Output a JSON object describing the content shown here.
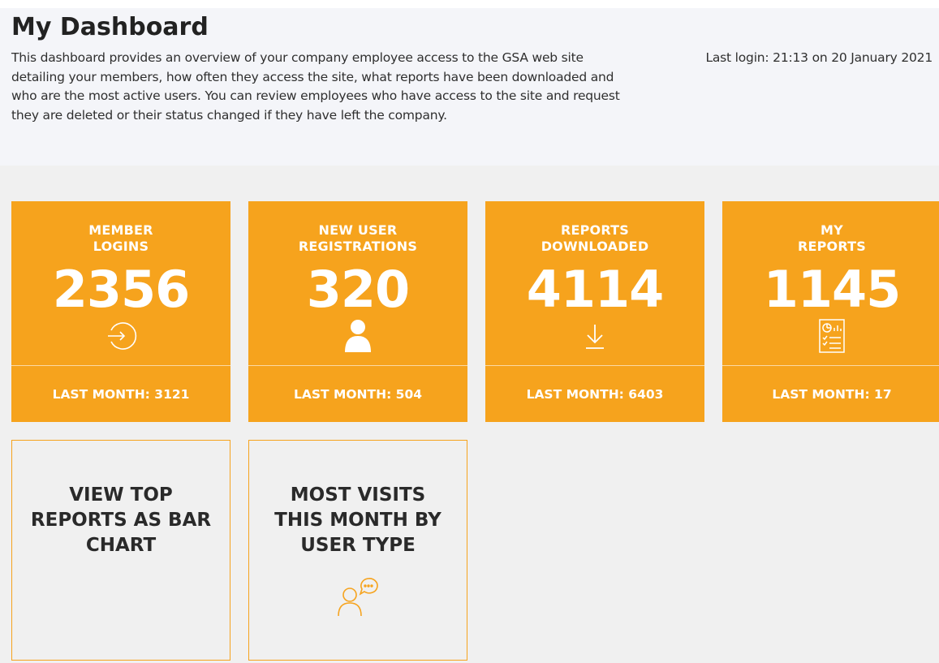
{
  "header": {
    "title": "My Dashboard",
    "description": "This dashboard provides an overview of your company employee access to the GSA web site detailing your members, how often they access the site, what reports have been downloaded and who are the most active users. You can review employees who have access to the site and request they are deleted or their status changed if they have left the company.",
    "last_login": "Last login: 21:13 on 20 January 2021"
  },
  "stats": [
    {
      "label_line1": "MEMBER",
      "label_line2": "LOGINS",
      "value": "2356",
      "icon": "login-icon",
      "footer": "LAST MONTH: 3121"
    },
    {
      "label_line1": "NEW USER",
      "label_line2": "REGISTRATIONS",
      "value": "320",
      "icon": "user-icon",
      "footer": "LAST MONTH: 504"
    },
    {
      "label_line1": "REPORTS",
      "label_line2": "DOWNLOADED",
      "value": "4114",
      "icon": "download-icon",
      "footer": "LAST MONTH: 6403"
    },
    {
      "label_line1": "MY",
      "label_line2": "REPORTS",
      "value": "1145",
      "icon": "report-document-icon",
      "footer": "LAST MONTH: 17"
    }
  ],
  "links": [
    {
      "label_line1": "VIEW TOP",
      "label_line2": "REPORTS AS BAR",
      "label_line3": "CHART"
    },
    {
      "label_line1": "MOST VISITS",
      "label_line2": "THIS MONTH BY",
      "label_line3": "USER TYPE",
      "icon": "user-chat-icon"
    }
  ],
  "colors": {
    "accent": "#f6a31d",
    "panel_bg": "#f0f0f0",
    "header_bg": "#f4f5f9"
  }
}
